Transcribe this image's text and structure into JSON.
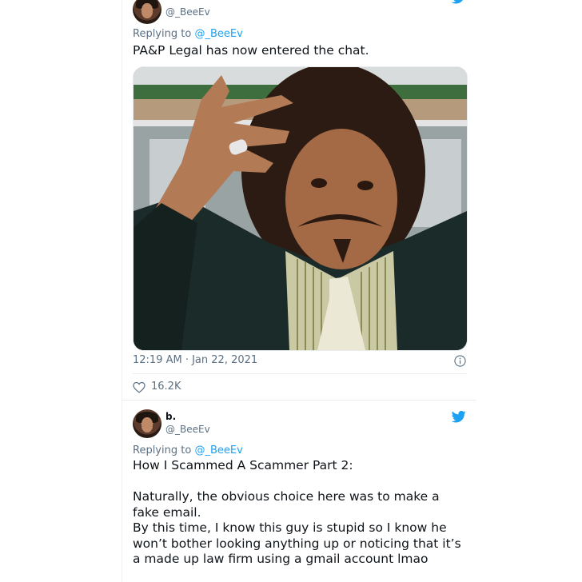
{
  "tweet1": {
    "handle": "@_BeeEv",
    "replying_prefix": "Replying to ",
    "replying_handle": "@_BeeEv",
    "text": "PA&P Legal has now entered the chat.",
    "timestamp": "12:19 AM · Jan 22, 2021",
    "likes": "16.2K"
  },
  "tweet2": {
    "name": "b.",
    "handle": "@_BeeEv",
    "replying_prefix": "Replying to ",
    "replying_handle": "@_BeeEv",
    "lines": [
      "How I Scammed A Scammer Part 2:",
      "",
      "Naturally, the obvious choice here was to make a",
      "fake email.",
      "By this time, I know this guy is stupid so I know he",
      "won’t bother looking anything up or noticing that it’s",
      "a made up law firm using a gmail account lmao"
    ]
  },
  "colors": {
    "accent": "#1da1f2",
    "muted": "#5b7083",
    "text": "#0f1419"
  },
  "icons": {
    "brand": "twitter-bird-icon",
    "like": "heart-icon",
    "info": "info-icon"
  }
}
